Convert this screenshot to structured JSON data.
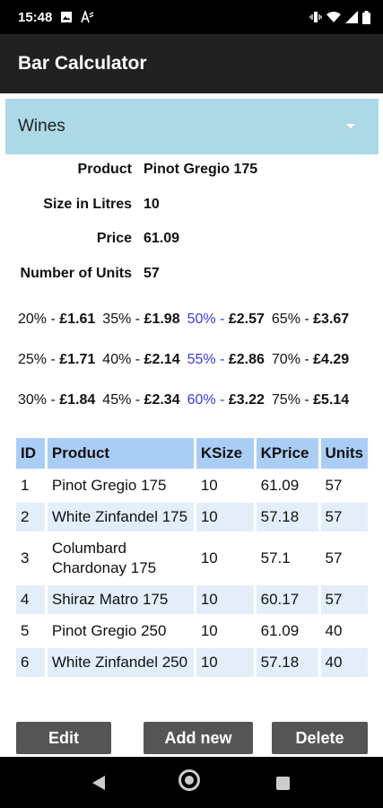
{
  "status": {
    "time": "15:48",
    "icons": [
      "image-icon",
      "font-icon",
      "vibrate-icon",
      "wifi-icon",
      "signal-icon",
      "battery-icon"
    ]
  },
  "app": {
    "title": "Bar Calculator"
  },
  "category": {
    "selected": "Wines"
  },
  "details": [
    {
      "label": "Product",
      "value": "Pinot Gregio 175"
    },
    {
      "label": "Size in Litres",
      "value": "10"
    },
    {
      "label": "Price",
      "value": "61.09"
    },
    {
      "label": "Number of Units",
      "value": "57"
    }
  ],
  "percentages": [
    [
      {
        "pct": "20% - ",
        "amount": "£1.61",
        "highlight": false
      },
      {
        "pct": "35% - ",
        "amount": "£1.98",
        "highlight": false
      },
      {
        "pct": "50% - ",
        "amount": "£2.57",
        "highlight": true
      },
      {
        "pct": "65% - ",
        "amount": "£3.67",
        "highlight": false
      }
    ],
    [
      {
        "pct": "25% - ",
        "amount": "£1.71",
        "highlight": false
      },
      {
        "pct": "40% - ",
        "amount": "£2.14",
        "highlight": false
      },
      {
        "pct": "55% - ",
        "amount": "£2.86",
        "highlight": true
      },
      {
        "pct": "70% - ",
        "amount": "£4.29",
        "highlight": false
      }
    ],
    [
      {
        "pct": "30% - ",
        "amount": "£1.84",
        "highlight": false
      },
      {
        "pct": "45% - ",
        "amount": "£2.34",
        "highlight": false
      },
      {
        "pct": "60% - ",
        "amount": "£3.22",
        "highlight": true
      },
      {
        "pct": "75% - ",
        "amount": "£5.14",
        "highlight": false
      }
    ]
  ],
  "table": {
    "headers": [
      "ID",
      "Product",
      "KSize",
      "KPrice",
      "Units"
    ],
    "rows": [
      [
        "1",
        "Pinot Gregio 175",
        "10",
        "61.09",
        "57"
      ],
      [
        "2",
        "White Zinfandel 175",
        "10",
        "57.18",
        "57"
      ],
      [
        "3",
        "Columbard Chardonay 175",
        "10",
        "57.1",
        "57"
      ],
      [
        "4",
        "Shiraz Matro 175",
        "10",
        "60.17",
        "57"
      ],
      [
        "5",
        "Pinot Gregio 250",
        "10",
        "61.09",
        "40"
      ],
      [
        "6",
        "White Zinfandel 250",
        "10",
        "57.18",
        "40"
      ]
    ]
  },
  "buttons": {
    "edit": "Edit",
    "add": "Add new",
    "delete": "Delete"
  },
  "colors": {
    "spinner": "#add8e6",
    "table_header": "#aacdf5",
    "highlight": "#3a3ad6"
  }
}
